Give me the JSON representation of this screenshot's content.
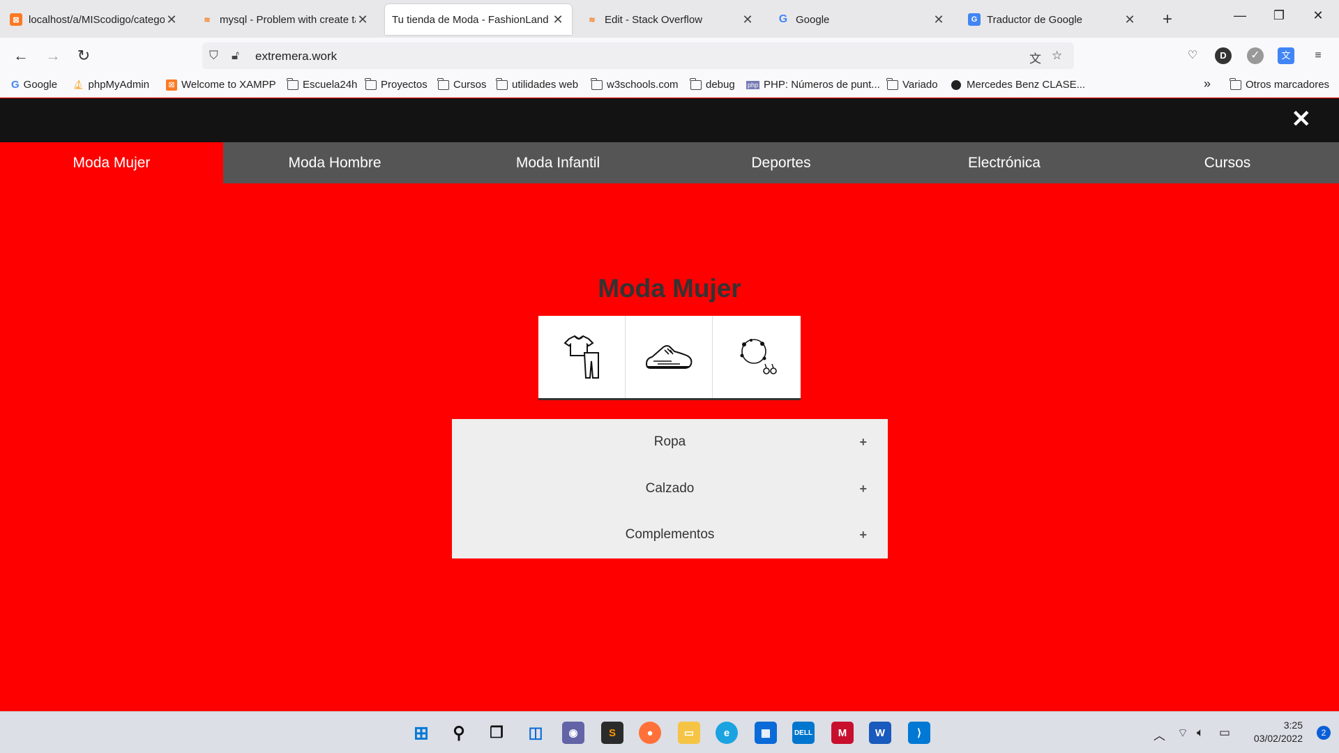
{
  "browser": {
    "tabs": [
      {
        "title": "localhost/a/MIScodigo/catego",
        "favicon": "xampp-icon",
        "active": false
      },
      {
        "title": "mysql - Problem with create ta",
        "favicon": "stackoverflow-icon",
        "active": false
      },
      {
        "title": "Tu tienda de Moda - FashionLand",
        "favicon": "",
        "active": true
      },
      {
        "title": "Edit - Stack Overflow",
        "favicon": "stackoverflow-icon",
        "active": false
      },
      {
        "title": "Google",
        "favicon": "google-icon",
        "active": false
      },
      {
        "title": "Traductor de Google",
        "favicon": "google-translate-icon",
        "active": false
      }
    ],
    "tab_close": "✕",
    "new_tab": "+",
    "url": "extremera.work",
    "bookmarks": [
      {
        "label": "Google",
        "icon": "google-icon"
      },
      {
        "label": "phpMyAdmin",
        "icon": "phpmyadmin-icon"
      },
      {
        "label": "Welcome to XAMPP",
        "icon": "xampp-icon"
      },
      {
        "label": "Escuela24h",
        "icon": "folder-icon"
      },
      {
        "label": "Proyectos",
        "icon": "folder-icon"
      },
      {
        "label": "Cursos",
        "icon": "folder-icon"
      },
      {
        "label": "utilidades web",
        "icon": "folder-icon"
      },
      {
        "label": "w3schools.com",
        "icon": "folder-icon"
      },
      {
        "label": "debug",
        "icon": "folder-icon"
      },
      {
        "label": "PHP: Números de punt...",
        "icon": "php-icon"
      },
      {
        "label": "Variado",
        "icon": "folder-icon"
      },
      {
        "label": "Mercedes Benz CLASE...",
        "icon": "mercedes-icon"
      }
    ],
    "other_bookmarks": "Otros marcadores",
    "profile_initial": "D"
  },
  "site": {
    "close_menu": "✕",
    "categories": [
      "Moda Mujer",
      "Moda Hombre",
      "Moda Infantil",
      "Deportes",
      "Electrónica",
      "Cursos"
    ],
    "active_category": "Moda Mujer",
    "title": "Moda Mujer",
    "icon_tiles": [
      "clothing-icon",
      "sneaker-icon",
      "jewelry-icon"
    ],
    "accordion": [
      {
        "label": "Ropa",
        "toggle": "+"
      },
      {
        "label": "Calzado",
        "toggle": "+"
      },
      {
        "label": "Complementos",
        "toggle": "+"
      }
    ],
    "colors": {
      "accent": "#ff0000",
      "nav": "#555555",
      "topbar": "#131313"
    }
  },
  "taskbar": {
    "time": "3:25",
    "date": "03/02/2022",
    "notifications": "2"
  }
}
